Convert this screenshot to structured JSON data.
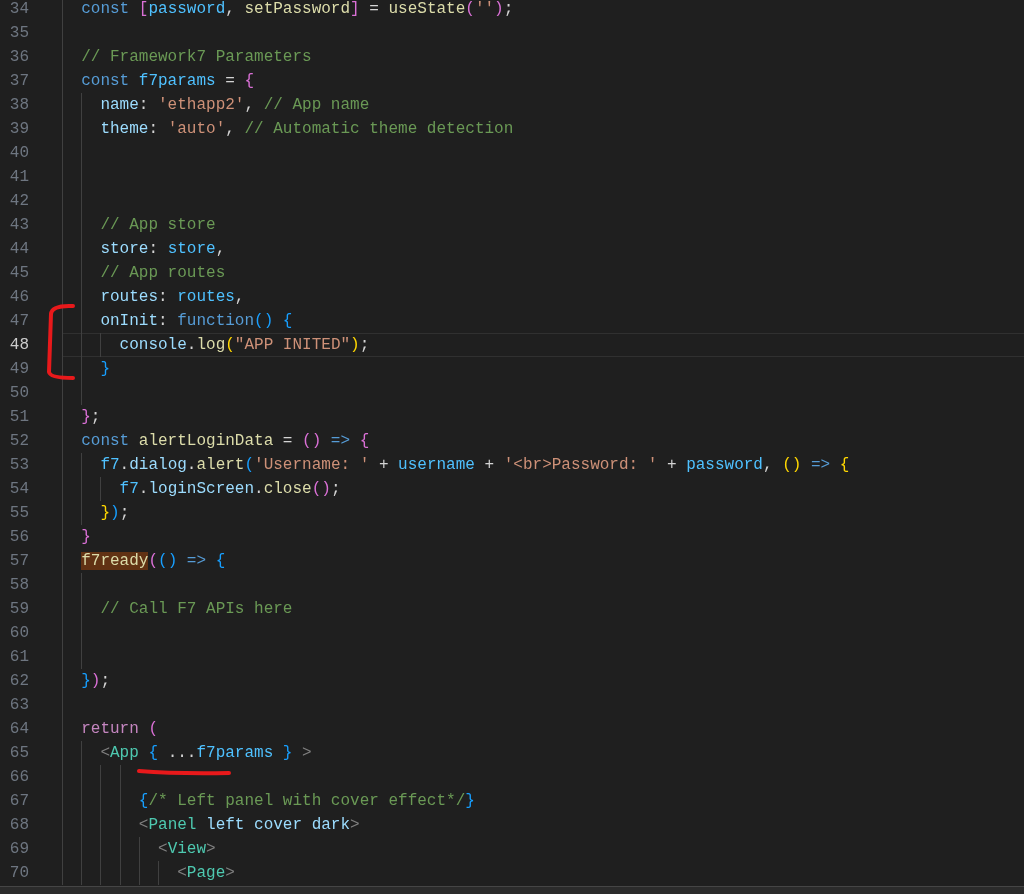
{
  "editor": {
    "lines": [
      {
        "number": "34",
        "current": false,
        "tokens": [
          {
            "kind": "keyword",
            "text": "  const "
          },
          {
            "kind": "bracket2",
            "text": "["
          },
          {
            "kind": "constant",
            "text": "password"
          },
          {
            "kind": "plain",
            "text": ", "
          },
          {
            "kind": "function",
            "text": "setPassword"
          },
          {
            "kind": "bracket2",
            "text": "]"
          },
          {
            "kind": "plain",
            "text": " = "
          },
          {
            "kind": "function",
            "text": "useState"
          },
          {
            "kind": "bracket2",
            "text": "("
          },
          {
            "kind": "string",
            "text": "''"
          },
          {
            "kind": "bracket2",
            "text": ")"
          },
          {
            "kind": "plain",
            "text": ";"
          }
        ]
      },
      {
        "number": "35",
        "current": false
      },
      {
        "number": "36",
        "current": false,
        "tokens": [
          {
            "kind": "comment",
            "text": "  // Framework7 Parameters"
          }
        ]
      },
      {
        "number": "37",
        "current": false,
        "tokens": [
          {
            "kind": "keyword",
            "text": "  const "
          },
          {
            "kind": "constant",
            "text": "f7params"
          },
          {
            "kind": "plain",
            "text": " = "
          },
          {
            "kind": "bracket2",
            "text": "{"
          }
        ]
      },
      {
        "number": "38",
        "current": false,
        "tokens": [
          {
            "kind": "property",
            "text": "    name"
          },
          {
            "kind": "plain",
            "text": ": "
          },
          {
            "kind": "string",
            "text": "'ethapp2'"
          },
          {
            "kind": "plain",
            "text": ", "
          },
          {
            "kind": "comment",
            "text": "// App name"
          }
        ]
      },
      {
        "number": "39",
        "current": false,
        "tokens": [
          {
            "kind": "property",
            "text": "    theme"
          },
          {
            "kind": "plain",
            "text": ": "
          },
          {
            "kind": "string",
            "text": "'auto'"
          },
          {
            "kind": "plain",
            "text": ", "
          },
          {
            "kind": "comment",
            "text": "// Automatic theme detection"
          }
        ]
      },
      {
        "number": "40",
        "current": false
      },
      {
        "number": "41",
        "current": false
      },
      {
        "number": "42",
        "current": false
      },
      {
        "number": "43",
        "current": false,
        "tokens": [
          {
            "kind": "comment",
            "text": "    // App store"
          }
        ]
      },
      {
        "number": "44",
        "current": false,
        "tokens": [
          {
            "kind": "property",
            "text": "    store"
          },
          {
            "kind": "plain",
            "text": ": "
          },
          {
            "kind": "constant",
            "text": "store"
          },
          {
            "kind": "plain",
            "text": ","
          }
        ]
      },
      {
        "number": "45",
        "current": false,
        "tokens": [
          {
            "kind": "comment",
            "text": "    // App routes"
          }
        ]
      },
      {
        "number": "46",
        "current": false,
        "tokens": [
          {
            "kind": "property",
            "text": "    routes"
          },
          {
            "kind": "plain",
            "text": ": "
          },
          {
            "kind": "constant",
            "text": "routes"
          },
          {
            "kind": "plain",
            "text": ","
          }
        ]
      },
      {
        "number": "47",
        "current": false,
        "tokens": [
          {
            "kind": "property",
            "text": "    onInit"
          },
          {
            "kind": "plain",
            "text": ": "
          },
          {
            "kind": "keyword",
            "text": "function"
          },
          {
            "kind": "bracket3",
            "text": "() "
          },
          {
            "kind": "bracket3",
            "text": "{"
          }
        ]
      },
      {
        "number": "48",
        "current": true,
        "tokens": [
          {
            "kind": "property",
            "text": "      console"
          },
          {
            "kind": "plain",
            "text": "."
          },
          {
            "kind": "function",
            "text": "log"
          },
          {
            "kind": "bracket1",
            "text": "("
          },
          {
            "kind": "string",
            "text": "\"APP INITED\""
          },
          {
            "kind": "bracket1",
            "text": ")"
          },
          {
            "kind": "plain",
            "text": ";"
          }
        ]
      },
      {
        "number": "49",
        "current": false,
        "tokens": [
          {
            "kind": "bracket3",
            "text": "    }"
          }
        ]
      },
      {
        "number": "50",
        "current": false
      },
      {
        "number": "51",
        "current": false,
        "tokens": [
          {
            "kind": "bracket2",
            "text": "  }"
          },
          {
            "kind": "plain",
            "text": ";"
          }
        ]
      },
      {
        "number": "52",
        "current": false,
        "tokens": [
          {
            "kind": "keyword",
            "text": "  const "
          },
          {
            "kind": "function",
            "text": "alertLoginData"
          },
          {
            "kind": "plain",
            "text": " = "
          },
          {
            "kind": "bracket2",
            "text": "() "
          },
          {
            "kind": "keyword",
            "text": "=> "
          },
          {
            "kind": "bracket2",
            "text": "{"
          }
        ]
      },
      {
        "number": "53",
        "current": false,
        "tokens": [
          {
            "kind": "constant",
            "text": "    f7"
          },
          {
            "kind": "plain",
            "text": "."
          },
          {
            "kind": "property",
            "text": "dialog"
          },
          {
            "kind": "plain",
            "text": "."
          },
          {
            "kind": "function",
            "text": "alert"
          },
          {
            "kind": "bracket3",
            "text": "("
          },
          {
            "kind": "string",
            "text": "'Username: '"
          },
          {
            "kind": "plain",
            "text": " + "
          },
          {
            "kind": "constant",
            "text": "username"
          },
          {
            "kind": "plain",
            "text": " + "
          },
          {
            "kind": "string",
            "text": "'<br>Password: '"
          },
          {
            "kind": "plain",
            "text": " + "
          },
          {
            "kind": "constant",
            "text": "password"
          },
          {
            "kind": "plain",
            "text": ", "
          },
          {
            "kind": "bracket1",
            "text": "() "
          },
          {
            "kind": "keyword",
            "text": "=> "
          },
          {
            "kind": "bracket1",
            "text": "{"
          }
        ]
      },
      {
        "number": "54",
        "current": false,
        "tokens": [
          {
            "kind": "constant",
            "text": "      f7"
          },
          {
            "kind": "plain",
            "text": "."
          },
          {
            "kind": "property",
            "text": "loginScreen"
          },
          {
            "kind": "plain",
            "text": "."
          },
          {
            "kind": "function",
            "text": "close"
          },
          {
            "kind": "bracket2",
            "text": "()"
          },
          {
            "kind": "plain",
            "text": ";"
          }
        ]
      },
      {
        "number": "55",
        "current": false,
        "tokens": [
          {
            "kind": "bracket1",
            "text": "    }"
          },
          {
            "kind": "bracket3",
            "text": ")"
          },
          {
            "kind": "plain",
            "text": ";"
          }
        ]
      },
      {
        "number": "56",
        "current": false,
        "tokens": [
          {
            "kind": "bracket2",
            "text": "  }"
          }
        ]
      },
      {
        "number": "57",
        "current": false,
        "tokens": [
          {
            "kind": "function",
            "text": "  f7ready",
            "highlighted": true
          },
          {
            "kind": "bracket2",
            "text": "("
          },
          {
            "kind": "bracket3",
            "text": "() "
          },
          {
            "kind": "keyword",
            "text": "=> "
          },
          {
            "kind": "bracket3",
            "text": "{"
          }
        ]
      },
      {
        "number": "58",
        "current": false
      },
      {
        "number": "59",
        "current": false,
        "tokens": [
          {
            "kind": "comment",
            "text": "    // Call F7 APIs here"
          }
        ]
      },
      {
        "number": "60",
        "current": false
      },
      {
        "number": "61",
        "current": false
      },
      {
        "number": "62",
        "current": false,
        "tokens": [
          {
            "kind": "bracket3",
            "text": "  }"
          },
          {
            "kind": "bracket2",
            "text": ")"
          },
          {
            "kind": "plain",
            "text": ";"
          }
        ]
      },
      {
        "number": "63",
        "current": false
      },
      {
        "number": "64",
        "current": false,
        "tokens": [
          {
            "kind": "control",
            "text": "  return "
          },
          {
            "kind": "bracket2",
            "text": "("
          }
        ]
      },
      {
        "number": "65",
        "current": false,
        "tokens": [
          {
            "kind": "tagpunct",
            "text": "    <"
          },
          {
            "kind": "tag",
            "text": "App "
          },
          {
            "kind": "bracket3",
            "text": "{"
          },
          {
            "kind": "plain",
            "text": " ..."
          },
          {
            "kind": "constant",
            "text": "f7params "
          },
          {
            "kind": "bracket3",
            "text": "} "
          },
          {
            "kind": "tagpunct",
            "text": ">"
          }
        ]
      },
      {
        "number": "66",
        "current": false
      },
      {
        "number": "67",
        "current": false,
        "tokens": [
          {
            "kind": "bracket3",
            "text": "        {"
          },
          {
            "kind": "comment",
            "text": "/* Left panel with cover effect*/"
          },
          {
            "kind": "bracket3",
            "text": "}"
          }
        ]
      },
      {
        "number": "68",
        "current": false,
        "tokens": [
          {
            "kind": "tagpunct",
            "text": "        <"
          },
          {
            "kind": "tag",
            "text": "Panel "
          },
          {
            "kind": "property",
            "text": "left cover dark"
          },
          {
            "kind": "tagpunct",
            "text": ">"
          }
        ]
      },
      {
        "number": "69",
        "current": false,
        "tokens": [
          {
            "kind": "tagpunct",
            "text": "          <"
          },
          {
            "kind": "tag",
            "text": "View"
          },
          {
            "kind": "tagpunct",
            "text": ">"
          }
        ]
      },
      {
        "number": "70",
        "current": false,
        "tokens": [
          {
            "kind": "tagpunct",
            "text": "            <"
          },
          {
            "kind": "tag",
            "text": "Page"
          },
          {
            "kind": "tagpunct",
            "text": ">"
          }
        ]
      }
    ]
  }
}
